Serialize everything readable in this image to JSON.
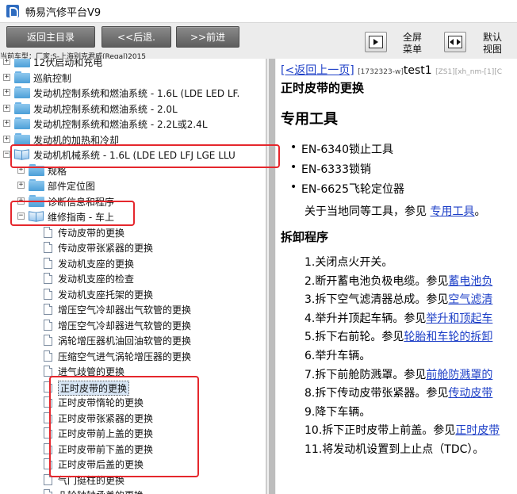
{
  "app": {
    "title": "畅易汽修平台V9"
  },
  "toolbar": {
    "home_label": "返回主目录",
    "back_label": "<<后退.",
    "forward_label": ">>前进",
    "fullscreen_label": "全屏菜单",
    "fullscreen_label_line1": "全屏",
    "fullscreen_label_line2": "菜单",
    "default_label_line1": "默认",
    "default_label_line2": "视图"
  },
  "vehicle": {
    "line": "当前车型：厂家:S-上海别克君威(Regal)2015"
  },
  "tree": {
    "items": [
      {
        "label": "12伏启动和充电",
        "kind": "folder",
        "expander": "+"
      },
      {
        "label": "巡航控制",
        "kind": "folder",
        "expander": "+"
      },
      {
        "label": "发动机控制系统和燃油系统 - 1.6L (LDE LED LF.",
        "kind": "folder",
        "expander": "+"
      },
      {
        "label": "发动机控制系统和燃油系统 - 2.0L",
        "kind": "folder",
        "expander": "+"
      },
      {
        "label": "发动机控制系统和燃油系统 - 2.2L或2.4L",
        "kind": "folder",
        "expander": "+"
      },
      {
        "label": "发动机的加热和冷却",
        "kind": "folder",
        "expander": "+"
      },
      {
        "label": "发动机机械系统 - 1.6L (LDE LED LFJ LGE LLU",
        "kind": "openbook",
        "expander": "-"
      },
      {
        "label": "规格",
        "kind": "folder",
        "expander": "+"
      },
      {
        "label": "部件定位图",
        "kind": "folder",
        "expander": "+"
      },
      {
        "label": "诊断信息和程序",
        "kind": "folder",
        "expander": "+"
      },
      {
        "label": "维修指南 - 车上",
        "kind": "openbook",
        "expander": "-"
      },
      {
        "label": "传动皮带的更换",
        "kind": "doc"
      },
      {
        "label": "传动皮带张紧器的更换",
        "kind": "doc"
      },
      {
        "label": "发动机支座的更换",
        "kind": "doc"
      },
      {
        "label": "发动机支座的检查",
        "kind": "doc"
      },
      {
        "label": "发动机支座托架的更换",
        "kind": "doc"
      },
      {
        "label": "增压空气冷却器出气软管的更换",
        "kind": "doc"
      },
      {
        "label": "增压空气冷却器进气软管的更换",
        "kind": "doc"
      },
      {
        "label": "涡轮增压器机油回油软管的更换",
        "kind": "doc"
      },
      {
        "label": "压缩空气进气涡轮增压器的更换",
        "kind": "doc"
      },
      {
        "label": "进气歧管的更换",
        "kind": "doc"
      },
      {
        "label": "正时皮带的更换",
        "kind": "doc",
        "selected": true
      },
      {
        "label": "正时皮带惰轮的更换",
        "kind": "doc"
      },
      {
        "label": "正时皮带张紧器的更换",
        "kind": "doc"
      },
      {
        "label": "正时皮带前上盖的更换",
        "kind": "doc"
      },
      {
        "label": "正时皮带前下盖的更换",
        "kind": "doc"
      },
      {
        "label": "正时皮带后盖的更换",
        "kind": "doc"
      },
      {
        "label": "气门挺柱的更换",
        "kind": "doc"
      },
      {
        "label": "凸轮轴轴承盖的更换",
        "kind": "doc"
      }
    ]
  },
  "doc": {
    "back_link": "<返回上一页",
    "code": "[1732323-w]",
    "test": "test1",
    "gray_code": "[ZS1][xh_nm-[1][C",
    "title": "正时皮带的更换",
    "tools_heading": "专用工具",
    "tools": [
      "EN-6340锁止工具",
      "EN-6333锁销",
      "EN-6625飞轮定位器"
    ],
    "note_prefix": "关于当地同等工具，参见 ",
    "note_link": "专用工具",
    "note_suffix": "。",
    "section": "拆卸程序",
    "steps": [
      {
        "text": "1.关闭点火开关。",
        "link": ""
      },
      {
        "text": "2.断开蓄电池负极电缆。参见",
        "link": "蓄电池负"
      },
      {
        "text": "3.拆下空气滤清器总成。参见",
        "link": "空气滤清"
      },
      {
        "text": "4.举升并顶起车辆。参见",
        "link": "举升和顶起车"
      },
      {
        "text": "5.拆下右前轮。参见",
        "link": "轮胎和车轮的拆卸"
      },
      {
        "text": "6.举升车辆。",
        "link": ""
      },
      {
        "text": "7.拆下前舱防溅罩。参见",
        "link": "前舱防溅罩的"
      },
      {
        "text": "8.拆下传动皮带张紧器。参见",
        "link": "传动皮带"
      },
      {
        "text": "9.降下车辆。",
        "link": ""
      },
      {
        "text": "10.拆下正时皮带上前盖。参见",
        "link": "正时皮带"
      },
      {
        "text": "11.将发动机设置到上止点（TDC）。",
        "link": ""
      }
    ]
  },
  "colors": {
    "highlight": "#e5272d",
    "link": "#1d3fc7",
    "toolbar_button": "#6e6e6e"
  }
}
